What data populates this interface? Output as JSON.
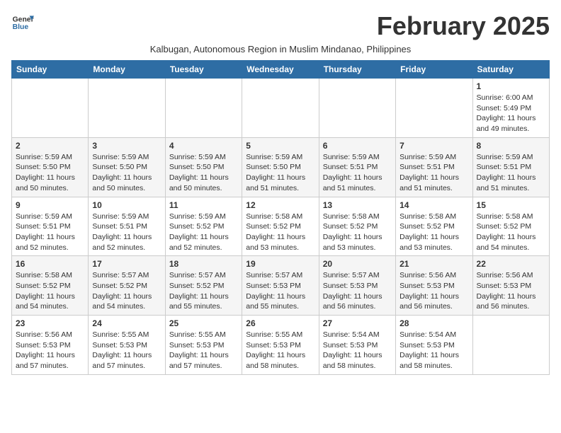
{
  "header": {
    "logo_line1": "General",
    "logo_line2": "Blue",
    "month_title": "February 2025",
    "subtitle": "Kalbugan, Autonomous Region in Muslim Mindanao, Philippines"
  },
  "days_of_week": [
    "Sunday",
    "Monday",
    "Tuesday",
    "Wednesday",
    "Thursday",
    "Friday",
    "Saturday"
  ],
  "weeks": [
    [
      {
        "day": "",
        "info": ""
      },
      {
        "day": "",
        "info": ""
      },
      {
        "day": "",
        "info": ""
      },
      {
        "day": "",
        "info": ""
      },
      {
        "day": "",
        "info": ""
      },
      {
        "day": "",
        "info": ""
      },
      {
        "day": "1",
        "info": "Sunrise: 6:00 AM\nSunset: 5:49 PM\nDaylight: 11 hours\nand 49 minutes."
      }
    ],
    [
      {
        "day": "2",
        "info": "Sunrise: 5:59 AM\nSunset: 5:50 PM\nDaylight: 11 hours\nand 50 minutes."
      },
      {
        "day": "3",
        "info": "Sunrise: 5:59 AM\nSunset: 5:50 PM\nDaylight: 11 hours\nand 50 minutes."
      },
      {
        "day": "4",
        "info": "Sunrise: 5:59 AM\nSunset: 5:50 PM\nDaylight: 11 hours\nand 50 minutes."
      },
      {
        "day": "5",
        "info": "Sunrise: 5:59 AM\nSunset: 5:50 PM\nDaylight: 11 hours\nand 51 minutes."
      },
      {
        "day": "6",
        "info": "Sunrise: 5:59 AM\nSunset: 5:51 PM\nDaylight: 11 hours\nand 51 minutes."
      },
      {
        "day": "7",
        "info": "Sunrise: 5:59 AM\nSunset: 5:51 PM\nDaylight: 11 hours\nand 51 minutes."
      },
      {
        "day": "8",
        "info": "Sunrise: 5:59 AM\nSunset: 5:51 PM\nDaylight: 11 hours\nand 51 minutes."
      }
    ],
    [
      {
        "day": "9",
        "info": "Sunrise: 5:59 AM\nSunset: 5:51 PM\nDaylight: 11 hours\nand 52 minutes."
      },
      {
        "day": "10",
        "info": "Sunrise: 5:59 AM\nSunset: 5:51 PM\nDaylight: 11 hours\nand 52 minutes."
      },
      {
        "day": "11",
        "info": "Sunrise: 5:59 AM\nSunset: 5:52 PM\nDaylight: 11 hours\nand 52 minutes."
      },
      {
        "day": "12",
        "info": "Sunrise: 5:58 AM\nSunset: 5:52 PM\nDaylight: 11 hours\nand 53 minutes."
      },
      {
        "day": "13",
        "info": "Sunrise: 5:58 AM\nSunset: 5:52 PM\nDaylight: 11 hours\nand 53 minutes."
      },
      {
        "day": "14",
        "info": "Sunrise: 5:58 AM\nSunset: 5:52 PM\nDaylight: 11 hours\nand 53 minutes."
      },
      {
        "day": "15",
        "info": "Sunrise: 5:58 AM\nSunset: 5:52 PM\nDaylight: 11 hours\nand 54 minutes."
      }
    ],
    [
      {
        "day": "16",
        "info": "Sunrise: 5:58 AM\nSunset: 5:52 PM\nDaylight: 11 hours\nand 54 minutes."
      },
      {
        "day": "17",
        "info": "Sunrise: 5:57 AM\nSunset: 5:52 PM\nDaylight: 11 hours\nand 54 minutes."
      },
      {
        "day": "18",
        "info": "Sunrise: 5:57 AM\nSunset: 5:52 PM\nDaylight: 11 hours\nand 55 minutes."
      },
      {
        "day": "19",
        "info": "Sunrise: 5:57 AM\nSunset: 5:53 PM\nDaylight: 11 hours\nand 55 minutes."
      },
      {
        "day": "20",
        "info": "Sunrise: 5:57 AM\nSunset: 5:53 PM\nDaylight: 11 hours\nand 56 minutes."
      },
      {
        "day": "21",
        "info": "Sunrise: 5:56 AM\nSunset: 5:53 PM\nDaylight: 11 hours\nand 56 minutes."
      },
      {
        "day": "22",
        "info": "Sunrise: 5:56 AM\nSunset: 5:53 PM\nDaylight: 11 hours\nand 56 minutes."
      }
    ],
    [
      {
        "day": "23",
        "info": "Sunrise: 5:56 AM\nSunset: 5:53 PM\nDaylight: 11 hours\nand 57 minutes."
      },
      {
        "day": "24",
        "info": "Sunrise: 5:55 AM\nSunset: 5:53 PM\nDaylight: 11 hours\nand 57 minutes."
      },
      {
        "day": "25",
        "info": "Sunrise: 5:55 AM\nSunset: 5:53 PM\nDaylight: 11 hours\nand 57 minutes."
      },
      {
        "day": "26",
        "info": "Sunrise: 5:55 AM\nSunset: 5:53 PM\nDaylight: 11 hours\nand 58 minutes."
      },
      {
        "day": "27",
        "info": "Sunrise: 5:54 AM\nSunset: 5:53 PM\nDaylight: 11 hours\nand 58 minutes."
      },
      {
        "day": "28",
        "info": "Sunrise: 5:54 AM\nSunset: 5:53 PM\nDaylight: 11 hours\nand 58 minutes."
      },
      {
        "day": "",
        "info": ""
      }
    ]
  ]
}
